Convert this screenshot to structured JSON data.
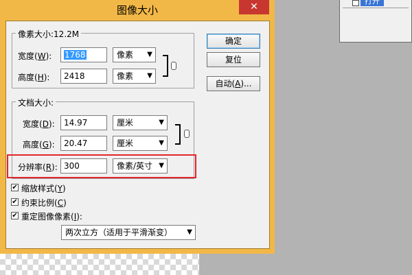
{
  "dialog": {
    "title": "图像大小",
    "close_label": "✕"
  },
  "pixel_dimensions": {
    "legend": "像素大小:12.2M",
    "width_label": "宽度(",
    "width_key": "W",
    "width_value": "1768",
    "width_unit": "像素",
    "height_label": "高度(",
    "height_key": "H",
    "height_value": "2418",
    "height_unit": "像素"
  },
  "document_size": {
    "legend": "文档大小:",
    "width_label": "宽度(",
    "width_key": "D",
    "width_value": "14.97",
    "width_unit": "厘米",
    "height_label": "高度(",
    "height_key": "G",
    "height_value": "20.47",
    "height_unit": "厘米",
    "resolution_label": "分辨率(",
    "resolution_key": "R",
    "resolution_value": "300",
    "resolution_unit": "像素/英寸"
  },
  "buttons": {
    "ok": "确定",
    "reset": "复位",
    "auto": "自动(",
    "auto_key": "A",
    "auto_suffix": ")..."
  },
  "options": {
    "scale_styles": "缩放样式(",
    "scale_styles_key": "Y",
    "constrain": "约束比例(",
    "constrain_key": "C",
    "resample": "重定图像像素(",
    "resample_key": "I",
    "resample_suffix": "):",
    "resample_method": "两次立方（适用于平滑渐变）"
  },
  "layers_panel": {
    "layer_label": "打开"
  },
  "colors": {
    "dialog_frame": "#f2b847",
    "close_button": "#c7372f",
    "highlight": "#e2252a",
    "selection": "#3399ff"
  }
}
